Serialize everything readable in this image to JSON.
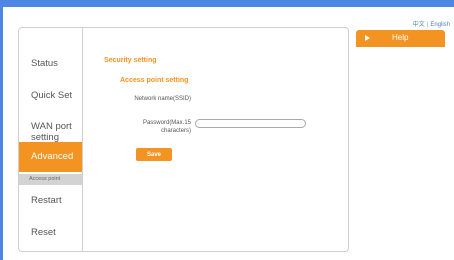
{
  "language": {
    "chinese": "中文",
    "separator": "|",
    "english": "English"
  },
  "sidebar": {
    "items": [
      {
        "label": "Status"
      },
      {
        "label": "Quick Set"
      },
      {
        "label": "WAN port setting"
      },
      {
        "label": "Advanced",
        "active": true
      },
      {
        "label": "Restart"
      },
      {
        "label": "Reset"
      }
    ],
    "sub_item": {
      "label": "Access point"
    }
  },
  "main": {
    "section_title": "Security setting",
    "sub_title": "Access point setting",
    "fields": {
      "ssid_label": "Network name(SSID)",
      "password_label": "Password(Max.15 characters)",
      "password_value": ""
    },
    "save_label": "Save"
  },
  "help": {
    "label": "Help"
  },
  "colors": {
    "accent": "#f39322",
    "frame": "#4f86e6",
    "link": "#4d7fbf"
  }
}
